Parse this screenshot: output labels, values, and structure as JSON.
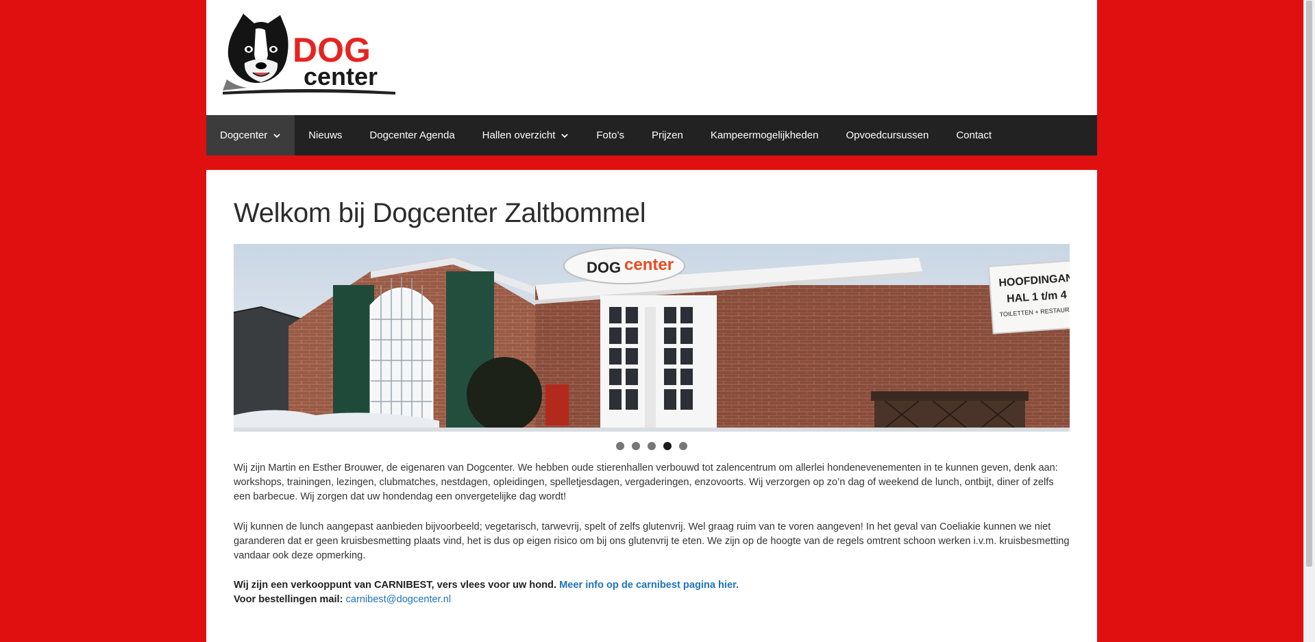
{
  "logo": {
    "text_dog": "DOG",
    "text_center": "center"
  },
  "nav": {
    "items": [
      {
        "label": "Dogcenter",
        "dropdown": true,
        "active": true
      },
      {
        "label": "Nieuws"
      },
      {
        "label": "Dogcenter Agenda"
      },
      {
        "label": "Hallen overzicht",
        "dropdown": true
      },
      {
        "label": "Foto’s"
      },
      {
        "label": "Prijzen"
      },
      {
        "label": "Kampeermogelijkheden"
      },
      {
        "label": "Opvoedcursussen"
      },
      {
        "label": "Contact"
      }
    ]
  },
  "page": {
    "title": "Welkom bij Dogcenter Zaltbommel"
  },
  "slider": {
    "sign_dog": "DOG",
    "sign_center": "center",
    "entrance_sign_line1": "HOOFDINGANG",
    "entrance_sign_line2": "HAL 1 t/m 4",
    "entrance_sign_line3": "TOILETTEN + RESTAURANT",
    "slide_count": 5,
    "active_slide": 4
  },
  "content": {
    "paragraph1": "Wij zijn Martin en Esther Brouwer, de eigenaren van Dogcenter. We hebben oude stierenhallen verbouwd tot zalencentrum om allerlei hondenevenementen in te kunnen geven, denk aan: workshops, trainingen, lezingen, clubmatches, nestdagen, opleidingen, spelletjesdagen, vergaderingen, enzovoorts. Wij verzorgen op zo’n dag of weekend de lunch, ontbijt, diner of zelfs een barbecue. Wij zorgen dat uw hondendag een onvergetelijke dag wordt!",
    "paragraph2": "Wij kunnen de lunch aangepast aanbieden bijvoorbeeld; vegetarisch, tarwevrij, spelt of zelfs glutenvrij. Wel graag ruim van te voren aangeven! In het geval van Coeliakie kunnen we niet garanderen dat er geen kruisbesmetting plaats vind, het is dus op eigen risico om bij ons glutenvrij te eten. We zijn op de hoogte van de regels omtrent schoon werken i.v.m. kruisbesmetting vandaar ook deze opmerking.",
    "carnibest_text": "Wij zijn een verkooppunt van CARNIBEST, vers vlees voor uw hond.",
    "carnibest_link": "Meer info op de carnibest pagina hier.",
    "orders_label": "Voor bestellingen mail:",
    "orders_email": "carnibest@dogcenter.nl"
  },
  "colors": {
    "background": "#e11010",
    "nav_bg": "#222222",
    "nav_active": "#3c3c3c",
    "link": "#1e73be",
    "logo_red": "#e52421"
  }
}
